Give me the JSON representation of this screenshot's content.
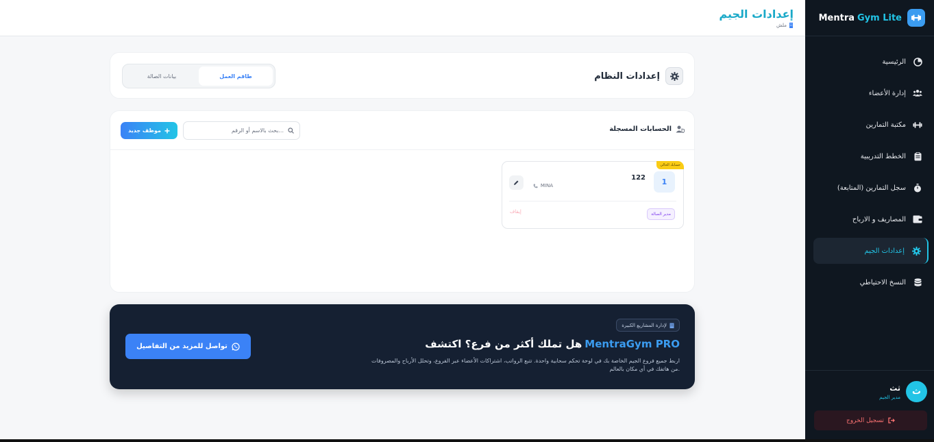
{
  "sidebar": {
    "brand_part1": "Mentra",
    "brand_part2": "Gym Lite",
    "items": [
      {
        "label": "الرئيسية",
        "icon": "chart-icon"
      },
      {
        "label": "إدارة الأعضاء",
        "icon": "users-icon"
      },
      {
        "label": "مكتبة التمارين",
        "icon": "dumbbell-icon"
      },
      {
        "label": "الخطط التدريبية",
        "icon": "clipboard-icon"
      },
      {
        "label": "سجل التمارين (المتابعة)",
        "icon": "stopwatch-icon"
      },
      {
        "label": "المصاريف و الارباح",
        "icon": "wallet-icon"
      },
      {
        "label": "إعدادات الجيم",
        "icon": "gear-icon",
        "active": true
      },
      {
        "label": "النسخ الاحتياطي",
        "icon": "database-icon"
      }
    ],
    "user": {
      "name": "ثث",
      "role": "مدير الجيم",
      "avatar_letter": "ث"
    },
    "logout_label": "تسجيل الخروج"
  },
  "header": {
    "title": "إعدادات الجيم",
    "subtitle": "ملش"
  },
  "settings": {
    "title": "إعدادات النظام",
    "tabs": [
      {
        "label": "طاقم العمل",
        "active": true
      },
      {
        "label": "بيانات الصالة",
        "active": false
      }
    ]
  },
  "accounts": {
    "title": "الحسابات المسجلة",
    "search_placeholder": "بحث بالاسم أو الرقم...",
    "add_label": "موظف جديد",
    "items": [
      {
        "index": "1",
        "name": "122",
        "phone": "MINA",
        "badge": "حسابك الحالي",
        "role": "مدير الصالة",
        "action": "إيقاف"
      }
    ]
  },
  "promo": {
    "tag": "لإدارة المشاريع الكبيرة",
    "title_prefix": "هل تملك أكثر من فرع؟ اكتشف",
    "title_highlight": "MentraGym PRO",
    "description": "اربط جميع فروع الجيم الخاصة بك في لوحة تحكم سحابية واحدة. تتبع الرواتب، اشتراكات الأعضاء عبر الفروع، وتحلل الأرباح والمصروفات من هاتفك في أي مكان بالعالم.",
    "button_label": "تواصل للمزيد من التفاصيل"
  },
  "colors": {
    "accent": "#22c4e6",
    "primary": "#3b82f6",
    "sidebar_bg": "#0f1720",
    "promo_bg": "#152032"
  }
}
